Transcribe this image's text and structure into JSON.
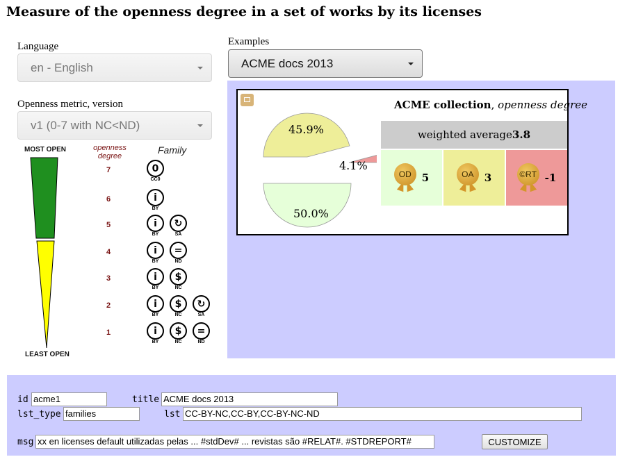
{
  "page": {
    "title": "Measure of the openness degree in a set of works by its licenses"
  },
  "controls": {
    "language": {
      "label": "Language",
      "value": "en - English"
    },
    "metric": {
      "label": "Openness metric, version",
      "value": "v1 (0-7 with NC<ND)"
    },
    "examples": {
      "label": "Examples",
      "value": "ACME docs 2013"
    }
  },
  "scale": {
    "top_label": "MOST OPEN",
    "bottom_label": "LEAST OPEN",
    "col_degree": "openness degree",
    "col_family": "Family",
    "colors": {
      "green": "#1f8f1f",
      "yellow": "#ffff00"
    },
    "levels": [
      {
        "degree": "7",
        "icons": [
          {
            "glyph": "0",
            "name": "cc-zero-icon",
            "caption": "CC0"
          }
        ]
      },
      {
        "degree": "6",
        "icons": [
          {
            "glyph": "i",
            "name": "cc-by-icon",
            "caption": "BY"
          }
        ]
      },
      {
        "degree": "5",
        "icons": [
          {
            "glyph": "i",
            "name": "cc-by-icon",
            "caption": "BY"
          },
          {
            "glyph": "↻",
            "name": "cc-sa-icon",
            "caption": "SA"
          }
        ]
      },
      {
        "degree": "4",
        "icons": [
          {
            "glyph": "i",
            "name": "cc-by-icon",
            "caption": "BY"
          },
          {
            "glyph": "=",
            "name": "cc-nd-icon",
            "caption": "ND"
          }
        ]
      },
      {
        "degree": "3",
        "icons": [
          {
            "glyph": "i",
            "name": "cc-by-icon",
            "caption": "BY"
          },
          {
            "glyph": "$",
            "name": "cc-nc-icon",
            "caption": "NC"
          }
        ]
      },
      {
        "degree": "2",
        "icons": [
          {
            "glyph": "i",
            "name": "cc-by-icon",
            "caption": "BY"
          },
          {
            "glyph": "$",
            "name": "cc-nc-icon",
            "caption": "NC"
          },
          {
            "glyph": "↻",
            "name": "cc-sa-icon",
            "caption": "SA"
          }
        ]
      },
      {
        "degree": "1",
        "icons": [
          {
            "glyph": "i",
            "name": "cc-by-icon",
            "caption": "BY"
          },
          {
            "glyph": "$",
            "name": "cc-nc-icon",
            "caption": "NC"
          },
          {
            "glyph": "=",
            "name": "cc-nd-icon",
            "caption": "ND"
          }
        ]
      }
    ]
  },
  "widget": {
    "title_bold": "ACME collection",
    "title_sep": ", ",
    "title_italic": "openness degree",
    "weighted_label": "weighted average ",
    "weighted_value": "3.8",
    "chart_data": {
      "type": "pie",
      "slices": [
        {
          "label": "45.9%",
          "value": 45.9,
          "color": "#eeee99"
        },
        {
          "label": "4.1%",
          "value": 4.1,
          "color": "#ee9999"
        },
        {
          "label": "50.0%",
          "value": 50.0,
          "color": "#e6ffd9"
        }
      ]
    },
    "boxes": [
      {
        "badge": "OD",
        "value": "5",
        "color": "#e6ffd9"
      },
      {
        "badge": "OA",
        "value": "3",
        "color": "#eeee99"
      },
      {
        "badge": "©RT",
        "value": "-1",
        "color": "#ee9999"
      }
    ],
    "panel_color": "#ccccff"
  },
  "form": {
    "id": {
      "label": "id",
      "value": "acme1"
    },
    "title": {
      "label": "title",
      "value": "ACME docs 2013"
    },
    "lst_type": {
      "label": "lst_type",
      "value": "families"
    },
    "lst": {
      "label": "lst",
      "value": "CC-BY-NC,CC-BY,CC-BY-NC-ND"
    },
    "msg": {
      "label": "msg",
      "value": "xx en licenses default utilizadas pelas ... #stdDev# ... revistas são #RELAT#. #STDREPORT#"
    },
    "customize_label": "CUSTOMIZE"
  }
}
